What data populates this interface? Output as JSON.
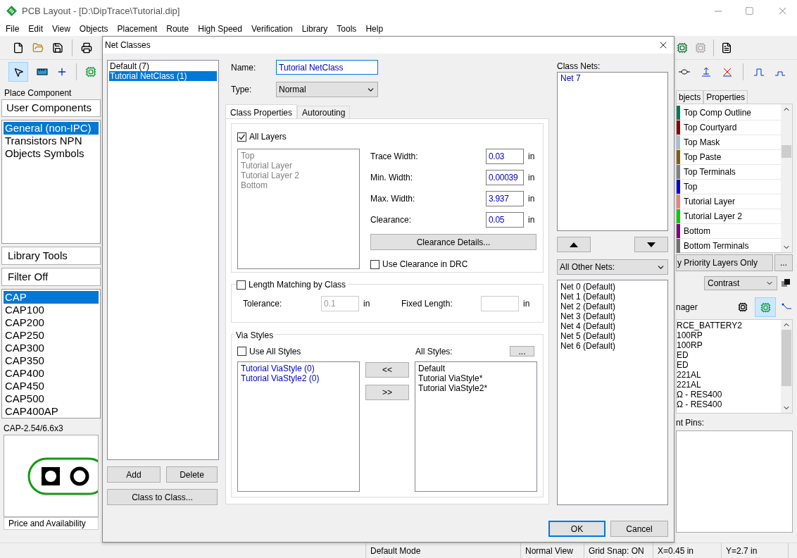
{
  "window": {
    "title": "PCB Layout - [D:\\DipTrace\\Tutorial.dip]"
  },
  "menu": [
    "File",
    "Edit",
    "View",
    "Objects",
    "Placement",
    "Route",
    "High Speed",
    "Verification",
    "Library",
    "Tools",
    "Help"
  ],
  "left_panel": {
    "header": "Place Component",
    "library_button": "User Components",
    "libraries": [
      {
        "label": "General (non-IPC)",
        "selected": true
      },
      {
        "label": "Transistors NPN",
        "selected": false
      },
      {
        "label": "Objects Symbols",
        "selected": false
      }
    ],
    "tools_button": "Library Tools",
    "filter_button": "Filter Off",
    "components": [
      {
        "label": "CAP",
        "selected": true
      },
      {
        "label": "CAP100",
        "selected": false
      },
      {
        "label": "CAP200",
        "selected": false
      },
      {
        "label": "CAP250",
        "selected": false
      },
      {
        "label": "CAP300",
        "selected": false
      },
      {
        "label": "CAP350",
        "selected": false
      },
      {
        "label": "CAP400",
        "selected": false
      },
      {
        "label": "CAP450",
        "selected": false
      },
      {
        "label": "CAP500",
        "selected": false
      },
      {
        "label": "CAP400AP",
        "selected": false
      }
    ],
    "pattern_name": "CAP-2.54/6.6x3",
    "price_button": "Price and Availability"
  },
  "right_panel": {
    "tabs": [
      "bjects",
      "Properties"
    ],
    "layers": [
      {
        "name": "Top Comp Outline",
        "color": "#007a5a"
      },
      {
        "name": "Top Courtyard",
        "color": "#8b0000"
      },
      {
        "name": "Top Mask",
        "color": "#a8c0cc"
      },
      {
        "name": "Top Paste",
        "color": "#806010"
      },
      {
        "name": "Top Terminals",
        "color": "#808080"
      },
      {
        "name": "Top",
        "color": "#0000e0"
      },
      {
        "name": "Tutorial Layer",
        "color": "#f08080"
      },
      {
        "name": "Tutorial Layer 2",
        "color": "#00d000"
      },
      {
        "name": "Bottom",
        "color": "#800080"
      },
      {
        "name": "Bottom Terminals",
        "color": "#707070"
      }
    ],
    "priority_button": "y Priority Layers Only",
    "more_button": "...",
    "contrast_select": "Contrast",
    "manager_title": "nager",
    "components": [
      "RCE_BATTERY2",
      "100RP",
      "100RP",
      "ED",
      "ED",
      "221AL",
      "221AL",
      "Ω - RES400",
      "Ω - RES400"
    ],
    "pins_label": "nt Pins:"
  },
  "status_bar": [
    "Default Mode",
    "Normal View",
    "Grid Snap: ON",
    "X=0.45 in",
    "Y=2.7 in"
  ],
  "dialog": {
    "title": "Net Classes",
    "classes": [
      {
        "label": "Default (7)",
        "selected": false
      },
      {
        "label": "Tutorial NetClass (1)",
        "selected": true
      }
    ],
    "add_button": "Add",
    "delete_button": "Delete",
    "class_to_class_button": "Class to Class...",
    "name": {
      "label": "Name:",
      "value": "Tutorial NetClass"
    },
    "type": {
      "label": "Type:",
      "value": "Normal"
    },
    "tabs": [
      {
        "label": "Class Properties",
        "selected": true
      },
      {
        "label": "Autorouting",
        "selected": false
      }
    ],
    "all_layers": {
      "label": "All Layers",
      "checked": true
    },
    "layers": {
      "disabled": true,
      "items": [
        "Top",
        "Tutorial Layer",
        "Tutorial Layer 2",
        "Bottom"
      ]
    },
    "widths": [
      {
        "label": "Trace Width:",
        "value": "0.03",
        "unit": "in"
      },
      {
        "label": "Min. Width:",
        "value": "0.00039",
        "unit": "in"
      },
      {
        "label": "Max. Width:",
        "value": "3.937",
        "unit": "in"
      },
      {
        "label": "Clearance:",
        "value": "0.05",
        "unit": "in"
      }
    ],
    "clearance_button": "Clearance Details...",
    "use_clearance_drc": {
      "label": "Use Clearance in DRC",
      "checked": false
    },
    "length_matching": {
      "label": "Length Matching by Class",
      "checked": false,
      "tolerance": {
        "label": "Tolerance:",
        "value": "0.1",
        "unit": "in",
        "disabled": true
      },
      "fixed_length": {
        "label": "Fixed Length:",
        "unit": "in"
      }
    },
    "via_styles": {
      "title": "Via Styles",
      "use_all": {
        "label": "Use All Styles",
        "checked": false
      },
      "class_styles": [
        "Tutorial ViaStyle (0)",
        "Tutorial ViaStyle2 (0)"
      ],
      "all_label": "All Styles:",
      "more_button": "...",
      "move_left": "<<",
      "move_right": ">>",
      "all_styles": [
        "Default",
        "Tutorial ViaStyle*",
        "Tutorial ViaStyle2*"
      ]
    },
    "class_nets": {
      "label": "Class Nets:",
      "nets": [
        "Net 7"
      ]
    },
    "other_nets": {
      "select": "All Other Nets:",
      "nets": [
        "Net 0 (Default)",
        "Net 1 (Default)",
        "Net 2 (Default)",
        "Net 3 (Default)",
        "Net 4 (Default)",
        "Net 5 (Default)",
        "Net 6 (Default)"
      ]
    },
    "ok_button": "OK",
    "cancel_button": "Cancel"
  }
}
